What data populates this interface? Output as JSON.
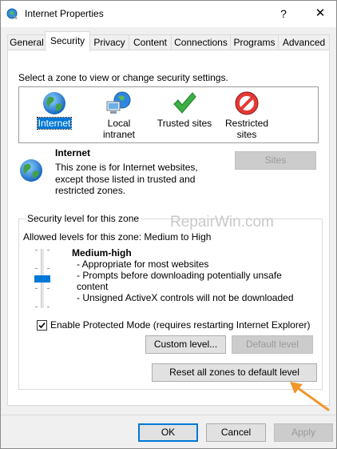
{
  "window": {
    "title": "Internet Properties"
  },
  "titlebar": {
    "help": "?",
    "close": "✕"
  },
  "tabs": [
    {
      "label": "General"
    },
    {
      "label": "Security"
    },
    {
      "label": "Privacy"
    },
    {
      "label": "Content"
    },
    {
      "label": "Connections"
    },
    {
      "label": "Programs"
    },
    {
      "label": "Advanced"
    }
  ],
  "security": {
    "zone_prompt": "Select a zone to view or change security settings.",
    "zones": [
      {
        "label": "Internet",
        "icon": "globe-icon"
      },
      {
        "label": "Local intranet",
        "icon": "intranet-icon"
      },
      {
        "label": "Trusted sites",
        "icon": "checkmark-icon"
      },
      {
        "label": "Restricted sites",
        "icon": "restricted-icon"
      }
    ],
    "selected_zone": "Internet",
    "zone_info": {
      "title": "Internet",
      "desc_lines": [
        "This zone is for Internet websites,",
        "except those listed in trusted and",
        "restricted zones."
      ]
    },
    "sites_button": "Sites",
    "level_group_title": "Security level for this zone",
    "allowed_levels": "Allowed levels for this zone: Medium to High",
    "level": {
      "title": "Medium-high",
      "lines": [
        "- Appropriate for most websites",
        "- Prompts before downloading potentially unsafe",
        "content",
        "- Unsigned ActiveX controls will not be downloaded"
      ]
    },
    "protected_mode_label": "Enable Protected Mode (requires restarting Internet Explorer)",
    "protected_mode_checked": true,
    "custom_level_button": "Custom level...",
    "default_level_button": "Default level",
    "reset_all_button": "Reset all zones to default level"
  },
  "watermark": "RepairWin.com",
  "dialog_buttons": {
    "ok": "OK",
    "cancel": "Cancel",
    "apply": "Apply"
  },
  "colors": {
    "accent": "#0078d7",
    "arrow": "#f0962c"
  }
}
